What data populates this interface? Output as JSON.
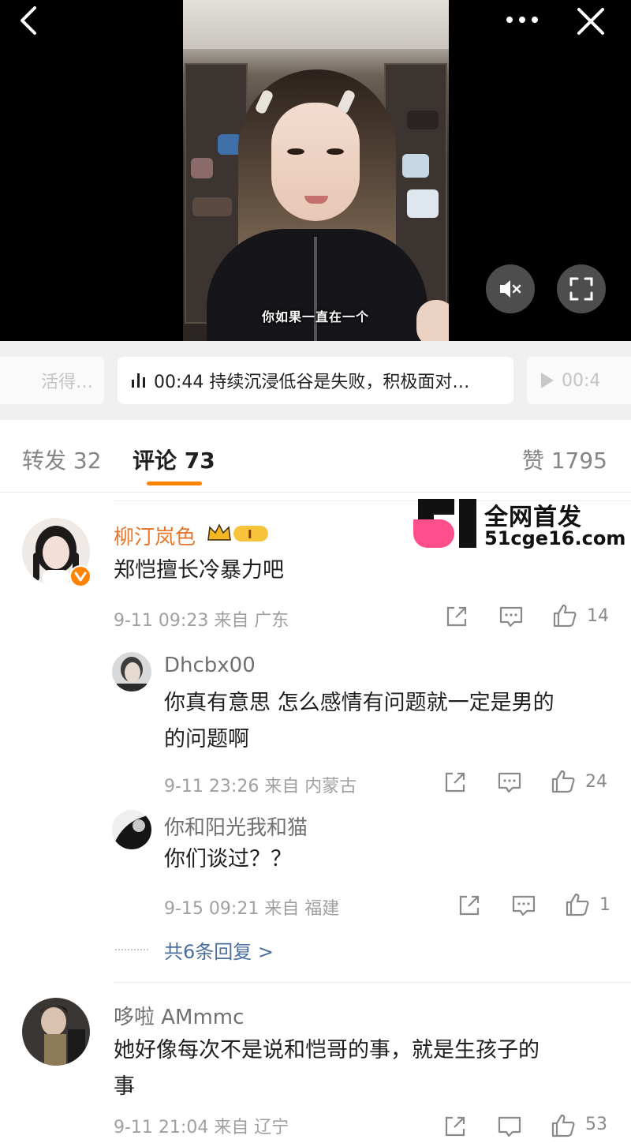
{
  "video": {
    "subtitle": "你如果一直在一个",
    "controls": [
      "back-icon",
      "more-icon",
      "close-icon",
      "mute-icon",
      "fullscreen-icon"
    ]
  },
  "chapters": {
    "prev": "活得…",
    "current": "00:44 持续沉浸低谷是失败，积极面对…",
    "next": "00:4"
  },
  "tabs": {
    "repost": "转发 32",
    "comment": "评论 73",
    "likes": "赞 1795",
    "active_color": "#ff8200"
  },
  "watermark": {
    "line1": "全网首发",
    "line2": "51cge16.com"
  },
  "comments": [
    {
      "user": "柳汀岚色",
      "name_color": "#e8762d",
      "text": "郑恺擅长冷暴力吧",
      "meta": "9-11 09:23  来自 广东",
      "likes": "14",
      "replies": [
        {
          "user": "Dhcbx00",
          "text_line1": "你真有意思 怎么感情有问题就一定是男的",
          "text_line2": "的问题啊",
          "meta": "9-11 23:26  来自 内蒙古",
          "likes": "24"
        },
        {
          "user": "你和阳光我和猫",
          "text_line1": "你们谈过？？",
          "meta": "9-15 09:21  来自 福建",
          "likes": "1"
        }
      ],
      "more_replies": "共6条回复 >"
    },
    {
      "user": "哆啦 AMmmc",
      "text_line1": "她好像每次不是说和恺哥的事，就是生孩子的",
      "text_line2": "事",
      "meta": "9-11 21:04  来自 辽宁",
      "likes": "53"
    }
  ]
}
